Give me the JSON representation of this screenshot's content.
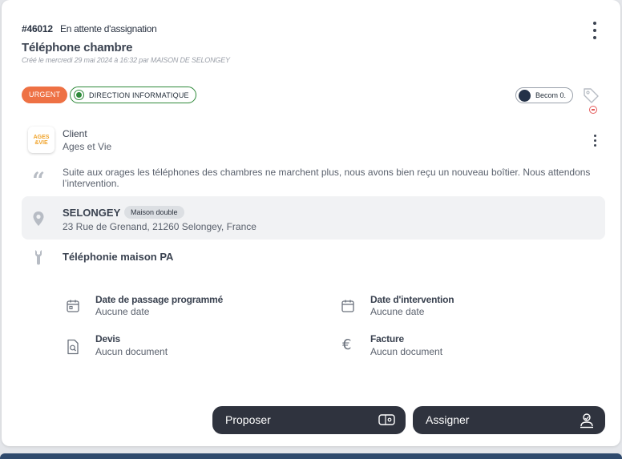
{
  "ticket": {
    "id": "#46012",
    "status": "En attente d'assignation",
    "title": "Téléphone chambre",
    "created": "Créé le mercredi 29 mai 2024 à 16:32  par MAISON DE SELONGEY"
  },
  "badges": {
    "priority": "URGENT",
    "department": "DIRECTION INFORMATIQUE",
    "assignee": "Becom 0."
  },
  "client": {
    "label": "Client",
    "name": "Ages et Vie",
    "logo_line1": "AGES",
    "logo_line2": "&VIE"
  },
  "description": "Suite aux orages les téléphones des chambres ne marchent plus, nous avons bien reçu un nouveau boîtier. Nous attendons l’intervention.",
  "address": {
    "city": "SELONGEY",
    "house_type": "Maison double",
    "street": "23 Rue de Grenand, 21260 Selongey, France"
  },
  "category": "Téléphonie maison PA",
  "info": {
    "scheduled_label": "Date de passage programmé",
    "scheduled_value": "Aucune date",
    "intervention_label": "Date d'intervention",
    "intervention_value": "Aucune date",
    "quote_label": "Devis",
    "quote_value": "Aucun document",
    "invoice_label": "Facture",
    "invoice_value": "Aucun document"
  },
  "actions": {
    "propose": "Proposer",
    "assign": "Assigner"
  },
  "icons": [
    "more-vertical-icon",
    "tag-icon",
    "minus-circle-icon",
    "quote-icon",
    "map-pin-icon",
    "wrench-icon",
    "calendar-icon",
    "document-search-icon",
    "euro-icon",
    "ticket-icon",
    "user-assign-icon"
  ],
  "colors": {
    "urgent": "#ee7144",
    "department": "#2f8a3a",
    "button": "#2f333e"
  }
}
